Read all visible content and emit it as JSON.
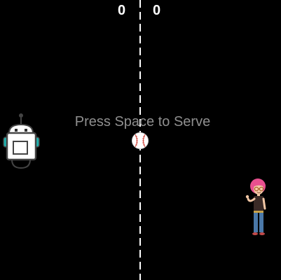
{
  "scoreboard": {
    "left_score": "0",
    "right_score": "0"
  },
  "prompt": {
    "text": "Press Space to Serve"
  },
  "sprites": {
    "left_paddle": "robot-sprite",
    "right_paddle": "girl-sprite",
    "ball": "baseball-sprite"
  },
  "colors": {
    "background": "#000000",
    "score": "#ffffff",
    "prompt": "#8f8f8f",
    "center_line": "#ffffff",
    "robot_accent": "#1fb3b0",
    "girl_hair": "#e8508f"
  }
}
